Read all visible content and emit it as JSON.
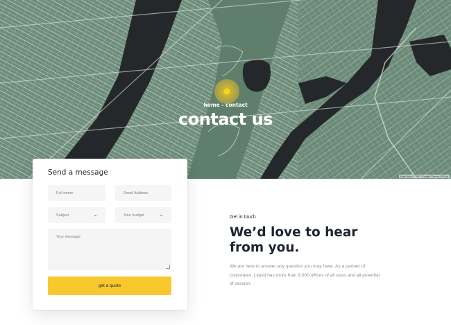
{
  "hero": {
    "breadcrumb": "home - contact",
    "title": "contact us",
    "map_attribution": "Map data ©2021 Google   Terms Of Use",
    "colors": {
      "land": "#6e8d7b",
      "water": "#25282a",
      "roads": "#d3ddd4",
      "pin": "#f7cd22"
    }
  },
  "form": {
    "title": "Send a message",
    "full_name_placeholder": "Full name",
    "email_placeholder": "Email Address",
    "subject_label": "Subject",
    "budget_label": "Your budget",
    "message_placeholder": "Your message",
    "submit_label": "get a quote",
    "chevron_icon": "chevron-down-icon",
    "accent_color": "#f9c82e"
  },
  "intro": {
    "eyebrow": "Get in touch",
    "headline": "We’d love to hear from you.",
    "body": "We are here to answer any question you may have. As a partner of corporates, Liquid has more than 9,000 offices of all sizes and all potential of session."
  }
}
